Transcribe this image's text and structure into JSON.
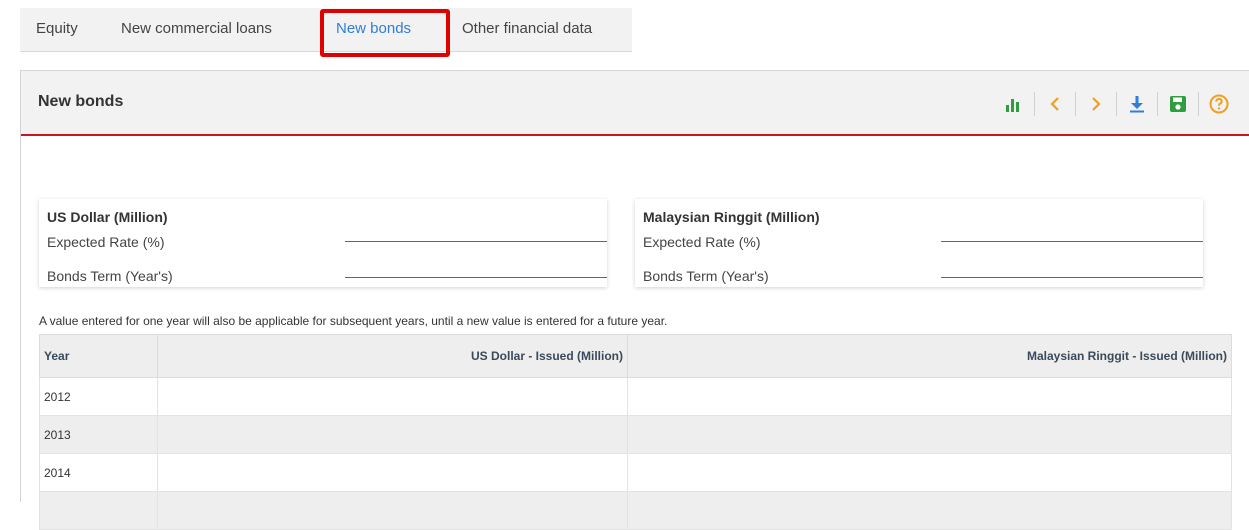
{
  "tabs": [
    {
      "label": "Equity"
    },
    {
      "label": "New commercial loans"
    },
    {
      "label": "New bonds"
    },
    {
      "label": "Other financial data"
    }
  ],
  "active_tab": "New bonds",
  "panel": {
    "title": "New bonds"
  },
  "toolbar": [
    {
      "icon": "bar-chart-icon",
      "color": "#2e9e3e"
    },
    {
      "icon": "chevron-left-icon",
      "color": "#f0a020"
    },
    {
      "icon": "chevron-right-icon",
      "color": "#f0a020"
    },
    {
      "icon": "download-icon",
      "color": "#2f7fd8"
    },
    {
      "icon": "save-icon",
      "color": "#2e9e3e"
    },
    {
      "icon": "help-icon",
      "color": "#f0a020"
    }
  ],
  "cards": [
    {
      "title": "US Dollar (Million)",
      "rate_label": "Expected Rate (%)",
      "term_label": "Bonds Term (Year's)",
      "rate_value": "",
      "term_value": ""
    },
    {
      "title": "Malaysian Ringgit (Million)",
      "rate_label": "Expected Rate (%)",
      "term_label": "Bonds Term (Year's)",
      "rate_value": "",
      "term_value": ""
    }
  ],
  "note": "A value entered for one year will also be applicable for subsequent years, until a new value is entered for a future year.",
  "table": {
    "columns": [
      "Year",
      "US Dollar - Issued (Million)",
      "Malaysian Ringgit - Issued (Million)"
    ],
    "rows": [
      {
        "year": "2012",
        "usd": "",
        "myr": ""
      },
      {
        "year": "2013",
        "usd": "",
        "myr": ""
      },
      {
        "year": "2014",
        "usd": "",
        "myr": ""
      },
      {
        "year": "",
        "usd": "",
        "myr": ""
      }
    ]
  },
  "colors": {
    "accent_red": "#c8161d",
    "link_blue": "#2f7fd8",
    "highlight": "#e00000"
  }
}
